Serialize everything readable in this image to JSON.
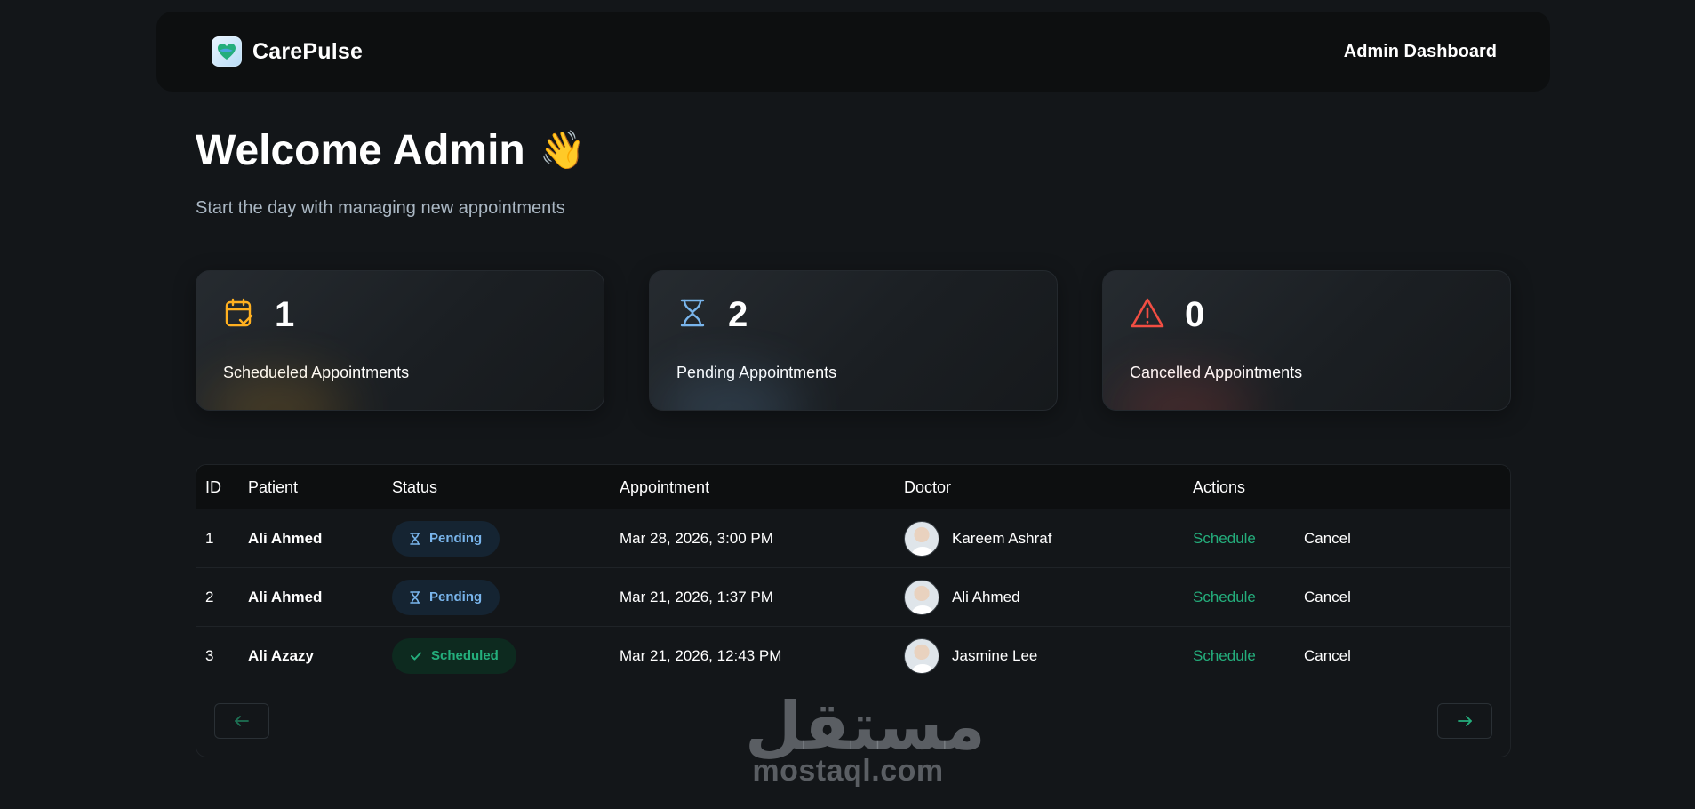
{
  "header": {
    "brand": "CarePulse",
    "right_label": "Admin Dashboard"
  },
  "welcome": {
    "title": "Welcome Admin",
    "emoji": "👋",
    "subtitle": "Start the day with managing new appointments"
  },
  "stats": [
    {
      "count": "1",
      "label": "Schedueled Appointments",
      "icon": "calendar-check-icon",
      "color": "#ffb020"
    },
    {
      "count": "2",
      "label": "Pending Appointments",
      "icon": "hourglass-icon",
      "color": "#79b5ec"
    },
    {
      "count": "0",
      "label": "Cancelled Appointments",
      "icon": "alert-triangle-icon",
      "color": "#f24e43"
    }
  ],
  "table": {
    "headers": [
      "ID",
      "Patient",
      "Status",
      "Appointment",
      "Doctor",
      "Actions"
    ],
    "rows": [
      {
        "id": "1",
        "patient": "Ali Ahmed",
        "status": "Pending",
        "appointment": "Mar 28, 2026, 3:00 PM",
        "doctor": "Kareem Ashraf",
        "schedule": "Schedule",
        "cancel": "Cancel"
      },
      {
        "id": "2",
        "patient": "Ali Ahmed",
        "status": "Pending",
        "appointment": "Mar 21, 2026, 1:37 PM",
        "doctor": "Ali Ahmed",
        "schedule": "Schedule",
        "cancel": "Cancel"
      },
      {
        "id": "3",
        "patient": "Ali Azazy",
        "status": "Scheduled",
        "appointment": "Mar 21, 2026, 12:43 PM",
        "doctor": "Jasmine Lee",
        "schedule": "Schedule",
        "cancel": "Cancel"
      }
    ]
  },
  "pagination": {
    "prev_icon": "arrow-left-icon",
    "next_icon": "arrow-right-icon"
  },
  "watermark": {
    "arabic": "مستقل",
    "latin": "mostaql.com"
  },
  "colors": {
    "background": "#131619",
    "accent_green": "#24ae7c",
    "pending_blue": "#79b5ec",
    "scheduled_orange": "#ffb020",
    "cancel_red": "#f24e43"
  }
}
